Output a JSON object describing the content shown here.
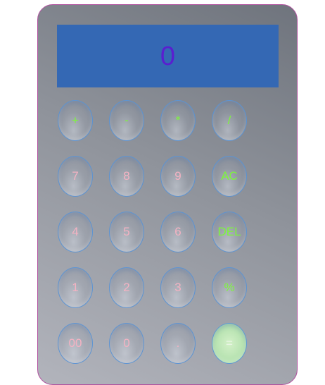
{
  "display": {
    "value": "0"
  },
  "keys": [
    {
      "name": "plus-button",
      "label": "+",
      "kind": "op"
    },
    {
      "name": "minus-button",
      "label": "-",
      "kind": "op"
    },
    {
      "name": "multiply-button",
      "label": "*",
      "kind": "op"
    },
    {
      "name": "divide-button",
      "label": "/",
      "kind": "op"
    },
    {
      "name": "seven-button",
      "label": "7",
      "kind": "num"
    },
    {
      "name": "eight-button",
      "label": "8",
      "kind": "num"
    },
    {
      "name": "nine-button",
      "label": "9",
      "kind": "num"
    },
    {
      "name": "all-clear-button",
      "label": "AC",
      "kind": "op"
    },
    {
      "name": "four-button",
      "label": "4",
      "kind": "num"
    },
    {
      "name": "five-button",
      "label": "5",
      "kind": "num"
    },
    {
      "name": "six-button",
      "label": "6",
      "kind": "num"
    },
    {
      "name": "delete-button",
      "label": "DEL",
      "kind": "op"
    },
    {
      "name": "one-button",
      "label": "1",
      "kind": "num"
    },
    {
      "name": "two-button",
      "label": "2",
      "kind": "num"
    },
    {
      "name": "three-button",
      "label": "3",
      "kind": "num"
    },
    {
      "name": "percent-button",
      "label": "%",
      "kind": "op"
    },
    {
      "name": "double-zero-button",
      "label": "00",
      "kind": "num"
    },
    {
      "name": "zero-button",
      "label": "0",
      "kind": "num"
    },
    {
      "name": "decimal-point-button",
      "label": ".",
      "kind": "num"
    },
    {
      "name": "equals-button",
      "label": "=",
      "kind": "equals"
    }
  ],
  "colors": {
    "display_background": "#3468b4",
    "display_text": "#5a1ed0",
    "operator_text": "#7cf63a",
    "number_text": "#f4b2c2",
    "key_border": "#5692d6",
    "equals_background": "#b6e2b0",
    "frame_border": "#b04f9e"
  }
}
